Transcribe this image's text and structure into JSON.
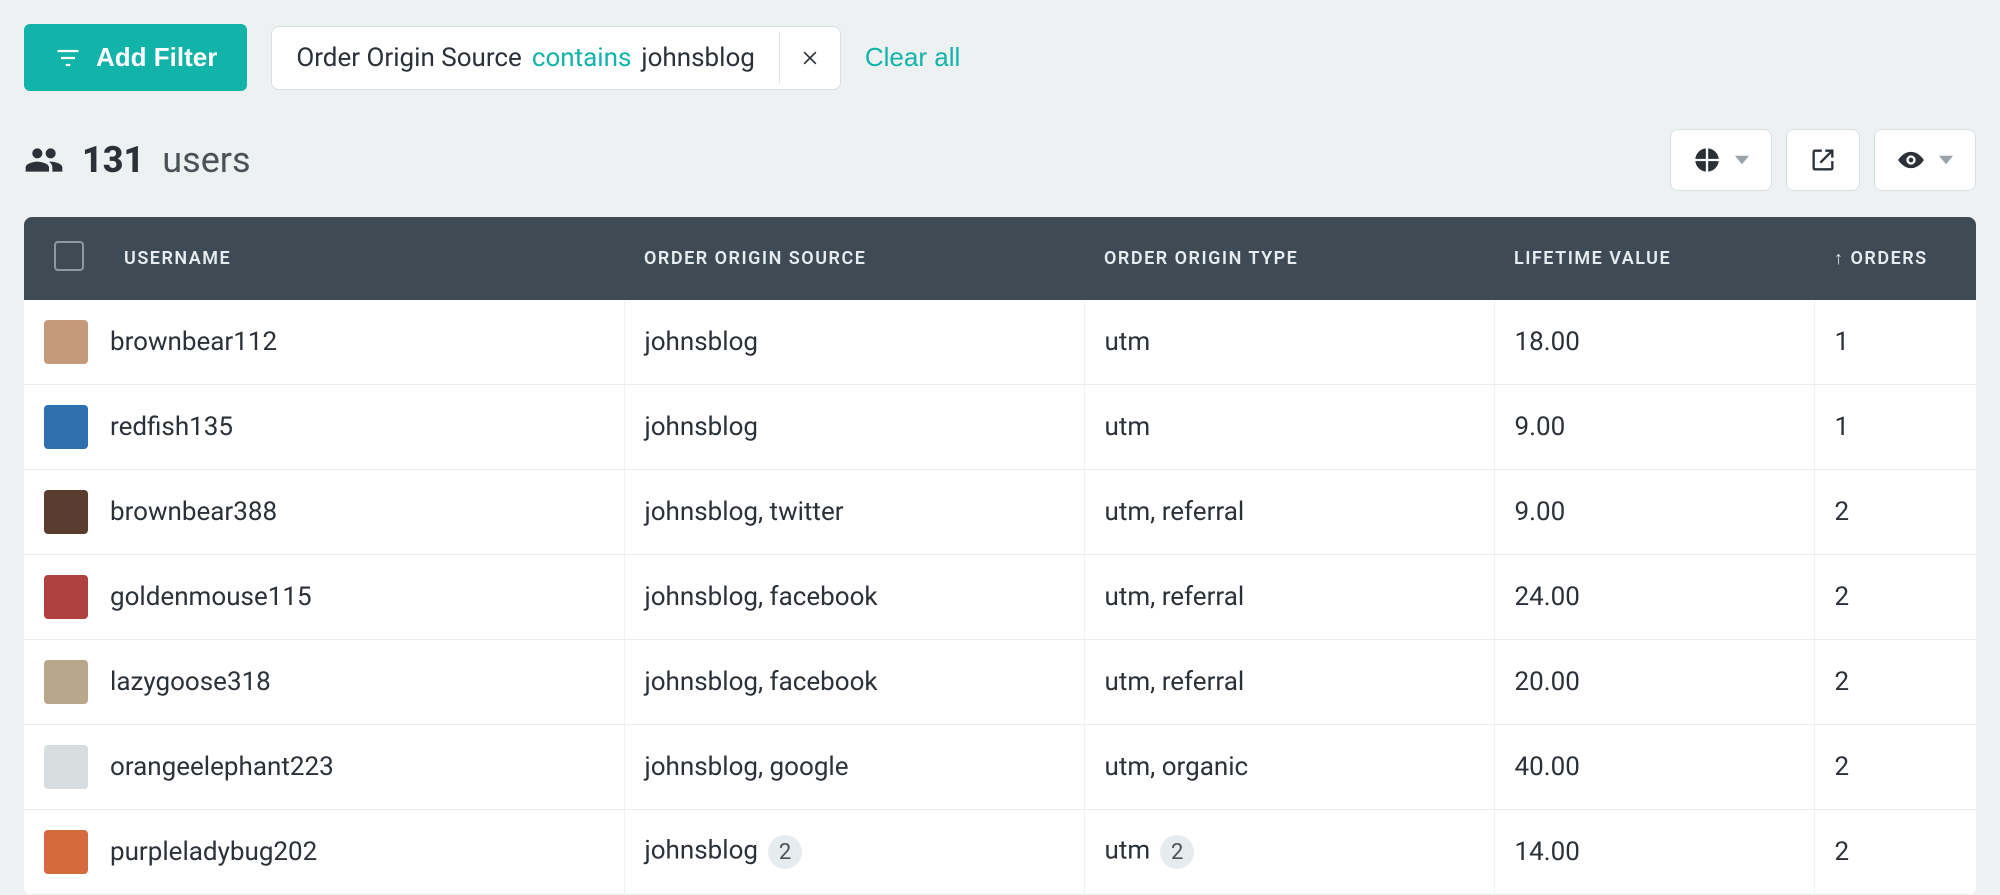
{
  "toolbar": {
    "add_filter_label": "Add Filter",
    "clear_all_label": "Clear all"
  },
  "filters": [
    {
      "field": "Order Origin Source",
      "operator": "contains",
      "value": "johnsblog"
    }
  ],
  "summary": {
    "count": "131",
    "unit": "users"
  },
  "action_icons": {
    "chart": "pie-chart-icon",
    "export": "open-in-new-icon",
    "visibility": "eye-icon"
  },
  "columns": {
    "username": "USERNAME",
    "origin_source": "ORDER ORIGIN SOURCE",
    "origin_type": "ORDER ORIGIN TYPE",
    "lifetime_value": "LIFETIME VALUE",
    "orders": "ORDERS",
    "orders_sort": "asc"
  },
  "rows": [
    {
      "avatar_color": "#c49a7a",
      "username": "brownbear112",
      "origin_source": "johnsblog",
      "origin_source_badge": null,
      "origin_type": "utm",
      "origin_type_badge": null,
      "lifetime_value": "18.00",
      "orders": "1"
    },
    {
      "avatar_color": "#2e6fb0",
      "username": "redfish135",
      "origin_source": "johnsblog",
      "origin_source_badge": null,
      "origin_type": "utm",
      "origin_type_badge": null,
      "lifetime_value": "9.00",
      "orders": "1"
    },
    {
      "avatar_color": "#5a3d2e",
      "username": "brownbear388",
      "origin_source": "johnsblog, twitter",
      "origin_source_badge": null,
      "origin_type": "utm, referral",
      "origin_type_badge": null,
      "lifetime_value": "9.00",
      "orders": "2"
    },
    {
      "avatar_color": "#b0413e",
      "username": "goldenmouse115",
      "origin_source": "johnsblog, facebook",
      "origin_source_badge": null,
      "origin_type": "utm, referral",
      "origin_type_badge": null,
      "lifetime_value": "24.00",
      "orders": "2"
    },
    {
      "avatar_color": "#b8a78b",
      "username": "lazygoose318",
      "origin_source": "johnsblog, facebook",
      "origin_source_badge": null,
      "origin_type": "utm, referral",
      "origin_type_badge": null,
      "lifetime_value": "20.00",
      "orders": "2"
    },
    {
      "avatar_color": "#d8dde0",
      "username": "orangeelephant223",
      "origin_source": "johnsblog, google",
      "origin_source_badge": null,
      "origin_type": "utm, organic",
      "origin_type_badge": null,
      "lifetime_value": "40.00",
      "orders": "2"
    },
    {
      "avatar_color": "#d46a3d",
      "username": "purpleladybug202",
      "origin_source": "johnsblog",
      "origin_source_badge": "2",
      "origin_type": "utm",
      "origin_type_badge": "2",
      "lifetime_value": "14.00",
      "orders": "2"
    }
  ]
}
